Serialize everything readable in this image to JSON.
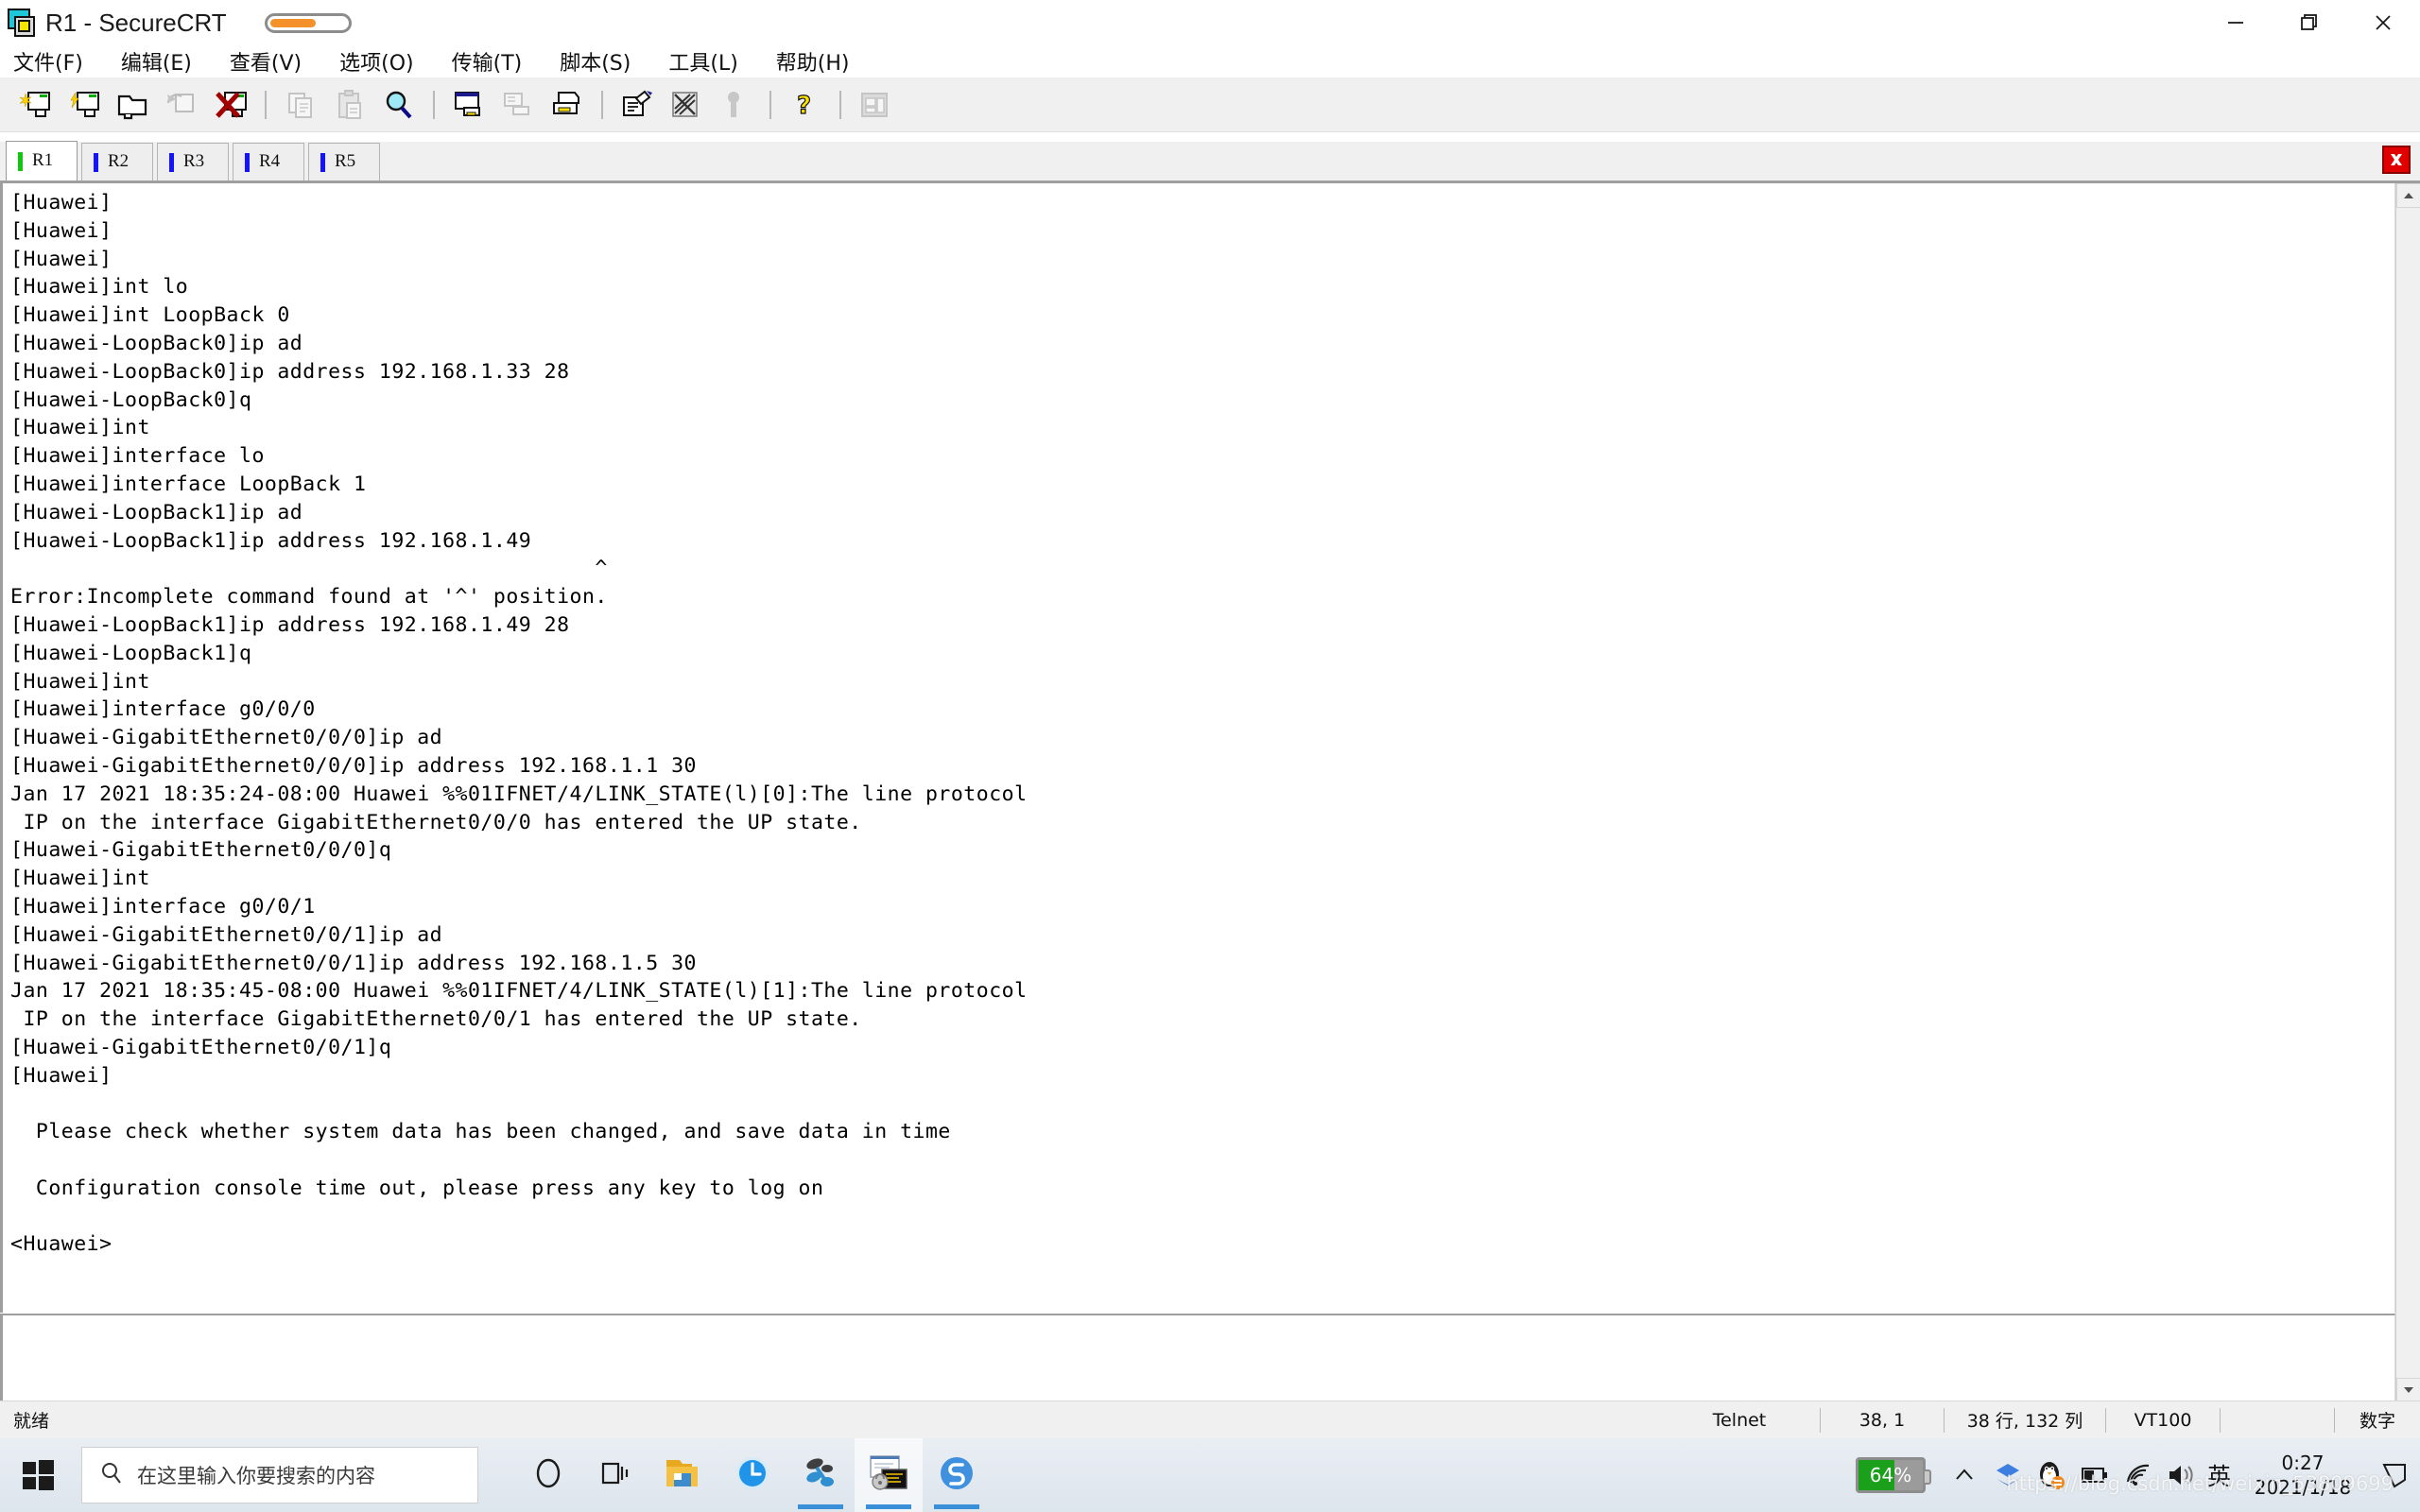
{
  "window": {
    "title": "R1 - SecureCRT",
    "icon": "securecrt-icon",
    "minimize_label": "—",
    "restore_label": "❐",
    "close_label": "✕"
  },
  "menubar": {
    "items": [
      {
        "label": "文件(F)",
        "name": "menu-file"
      },
      {
        "label": "编辑(E)",
        "name": "menu-edit"
      },
      {
        "label": "查看(V)",
        "name": "menu-view"
      },
      {
        "label": "选项(O)",
        "name": "menu-options"
      },
      {
        "label": "传输(T)",
        "name": "menu-transfer"
      },
      {
        "label": "脚本(S)",
        "name": "menu-script"
      },
      {
        "label": "工具(L)",
        "name": "menu-tools"
      },
      {
        "label": "帮助(H)",
        "name": "menu-help"
      }
    ]
  },
  "toolbar": {
    "buttons": [
      {
        "name": "new-session-icon",
        "enabled": true
      },
      {
        "name": "quick-connect-icon",
        "enabled": true
      },
      {
        "name": "open-folder-icon",
        "enabled": true
      },
      {
        "name": "reconnect-icon",
        "enabled": false
      },
      {
        "name": "disconnect-icon",
        "enabled": true
      },
      {
        "name": "copy-icon",
        "enabled": false
      },
      {
        "name": "paste-icon",
        "enabled": false
      },
      {
        "name": "find-icon",
        "enabled": true
      },
      {
        "name": "print-screen-icon",
        "enabled": true
      },
      {
        "name": "log-session-icon",
        "enabled": false
      },
      {
        "name": "print-icon",
        "enabled": true
      },
      {
        "name": "edit-session-icon",
        "enabled": true
      },
      {
        "name": "session-options-icon",
        "enabled": true
      },
      {
        "name": "key-icon",
        "enabled": false
      },
      {
        "name": "help-icon",
        "enabled": true
      },
      {
        "name": "keymap-editor-icon",
        "enabled": false
      }
    ]
  },
  "tabs": {
    "items": [
      {
        "label": "R1",
        "active": true,
        "indicator_color": "#0ec70e"
      },
      {
        "label": "R2",
        "active": false,
        "indicator_color": "#1414ff"
      },
      {
        "label": "R3",
        "active": false,
        "indicator_color": "#1414ff"
      },
      {
        "label": "R4",
        "active": false,
        "indicator_color": "#1414ff"
      },
      {
        "label": "R5",
        "active": false,
        "indicator_color": "#1414ff"
      }
    ],
    "close_label": "✖"
  },
  "terminal": {
    "lines": [
      "[Huawei]",
      "[Huawei]",
      "[Huawei]",
      "[Huawei]int lo",
      "[Huawei]int LoopBack 0",
      "[Huawei-LoopBack0]ip ad",
      "[Huawei-LoopBack0]ip address 192.168.1.33 28",
      "[Huawei-LoopBack0]q",
      "[Huawei]int",
      "[Huawei]interface lo",
      "[Huawei]interface LoopBack 1",
      "[Huawei-LoopBack1]ip ad",
      "[Huawei-LoopBack1]ip address 192.168.1.49",
      "                                              ^",
      "Error:Incomplete command found at '^' position.",
      "[Huawei-LoopBack1]ip address 192.168.1.49 28",
      "[Huawei-LoopBack1]q",
      "[Huawei]int",
      "[Huawei]interface g0/0/0",
      "[Huawei-GigabitEthernet0/0/0]ip ad",
      "[Huawei-GigabitEthernet0/0/0]ip address 192.168.1.1 30",
      "Jan 17 2021 18:35:24-08:00 Huawei %%01IFNET/4/LINK_STATE(l)[0]:The line protocol",
      " IP on the interface GigabitEthernet0/0/0 has entered the UP state.",
      "[Huawei-GigabitEthernet0/0/0]q",
      "[Huawei]int",
      "[Huawei]interface g0/0/1",
      "[Huawei-GigabitEthernet0/0/1]ip ad",
      "[Huawei-GigabitEthernet0/0/1]ip address 192.168.1.5 30",
      "Jan 17 2021 18:35:45-08:00 Huawei %%01IFNET/4/LINK_STATE(l)[1]:The line protocol",
      " IP on the interface GigabitEthernet0/0/1 has entered the UP state.",
      "[Huawei-GigabitEthernet0/0/1]q",
      "[Huawei]",
      "",
      "  Please check whether system data has been changed, and save data in time",
      "",
      "  Configuration console time out, please press any key to log on",
      "",
      "<Huawei>"
    ]
  },
  "statusbar": {
    "ready": "就绪",
    "protocol": "Telnet",
    "cursor": "38,  1",
    "size": "38 行, 132 列",
    "emulation": "VT100",
    "num": "数字"
  },
  "taskbar": {
    "start_name": "windows-start-icon",
    "search_placeholder": "在这里输入你要搜索的内容",
    "tasks": [
      {
        "name": "cortana-icon",
        "running": false,
        "active": false
      },
      {
        "name": "task-view-icon",
        "running": false,
        "active": false
      },
      {
        "name": "file-explorer-icon",
        "running": false,
        "active": false
      },
      {
        "name": "clock-app-icon",
        "running": false,
        "active": false
      },
      {
        "name": "ensp-icon",
        "running": true,
        "active": false
      },
      {
        "name": "securecrt-icon",
        "running": true,
        "active": true
      },
      {
        "name": "s-app-icon",
        "running": true,
        "active": false
      }
    ],
    "tray": {
      "battery_percent": "64%",
      "show_hidden_icons": "chevron-up-icon",
      "icons": [
        "sogou-layers-icon",
        "qq-penguin-icon",
        "battery-tray-icon",
        "wifi-icon",
        "volume-icon"
      ],
      "ime": "英",
      "time": "0:27",
      "date": "2021/1/18",
      "notification": "action-center-icon"
    },
    "watermark": "https://blog.csdn.net/weixin_53809699"
  }
}
